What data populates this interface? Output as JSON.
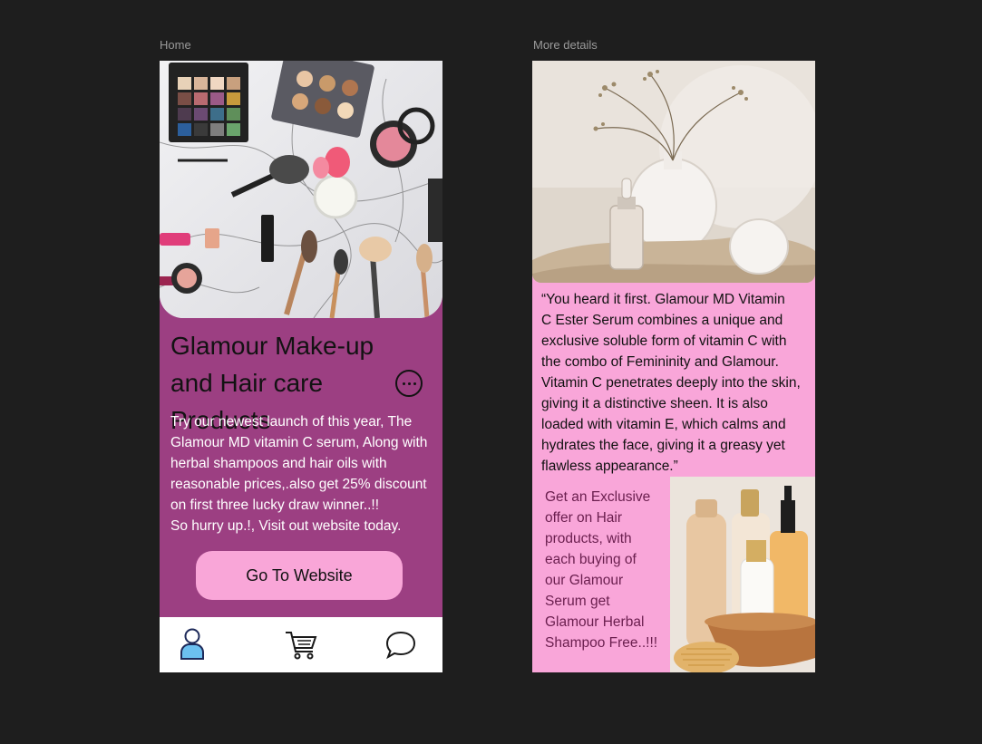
{
  "frames": {
    "home": {
      "label": "Home"
    },
    "details": {
      "label": "More details"
    }
  },
  "home": {
    "title": "Glamour Make-up and Hair care Products",
    "description_lines": [
      "Try our newest launch of this year, The",
      "Glamour MD vitamin C serum, Along with",
      "herbal shampoos and hair oils with",
      "reasonable prices,.also get 25% discount",
      "on first three lucky draw winner..!!",
      "So hurry up.!, Visit out website today."
    ],
    "cta_label": "Go To Website",
    "more_icon": "more-horizontal-circle-icon",
    "tabs": [
      {
        "icon": "user-icon"
      },
      {
        "icon": "cart-icon"
      },
      {
        "icon": "chat-bubble-icon"
      }
    ]
  },
  "details": {
    "quote_lines": [
      "“You heard it first. Glamour MD Vitamin",
      "C Ester Serum combines a unique and",
      "exclusive soluble form of vitamin C with",
      "the combo of Femininity and Glamour.",
      "Vitamin C penetrates deeply into the skin,",
      "giving it a distinctive sheen. It is also",
      "loaded with vitamin E, which calms and",
      "hydrates the face, giving it a greasy yet",
      "flawless appearance.”"
    ],
    "offer_lines": [
      "Get an Exclusive",
      "offer on Hair",
      "products, with",
      "each buying of",
      "our Glamour",
      "Serum get",
      "Glamour Herbal",
      "Shampoo Free..!!!"
    ]
  },
  "colors": {
    "canvas": "#1e1e1e",
    "home_background": "#9c3f82",
    "accent_pink": "#f9a6d8",
    "offer_text": "#6a1e4e"
  }
}
